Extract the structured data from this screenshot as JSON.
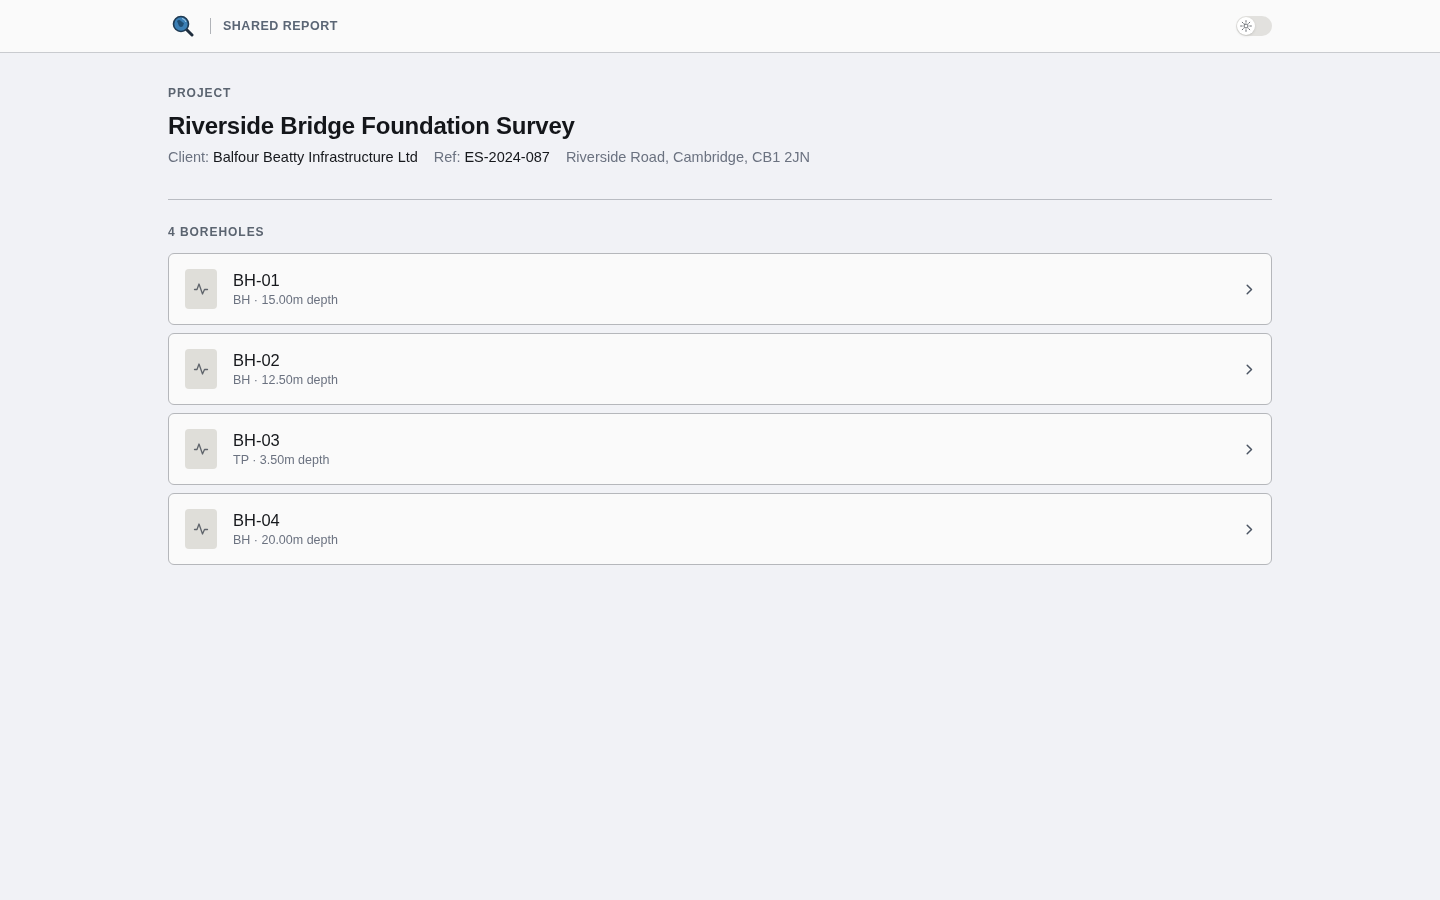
{
  "header": {
    "title": "SHARED REPORT",
    "theme_toggle": {
      "on": false
    }
  },
  "project": {
    "eyebrow": "PROJECT",
    "title": "Riverside Bridge Foundation Survey",
    "meta": [
      {
        "label": "Client:",
        "value": "Balfour Beatty Infrastructure Ltd"
      },
      {
        "label": "Ref:",
        "value": "ES-2024-087"
      },
      {
        "text": "Riverside Road, Cambridge, CB1 2JN"
      }
    ]
  },
  "boreholes": {
    "heading": "4 BOREHOLES",
    "items": [
      {
        "name": "BH-01",
        "details": "BH · 15.00m depth"
      },
      {
        "name": "BH-02",
        "details": "BH · 12.50m depth"
      },
      {
        "name": "BH-03",
        "details": "TP · 3.50m depth"
      },
      {
        "name": "BH-04",
        "details": "BH · 20.00m depth"
      }
    ]
  }
}
